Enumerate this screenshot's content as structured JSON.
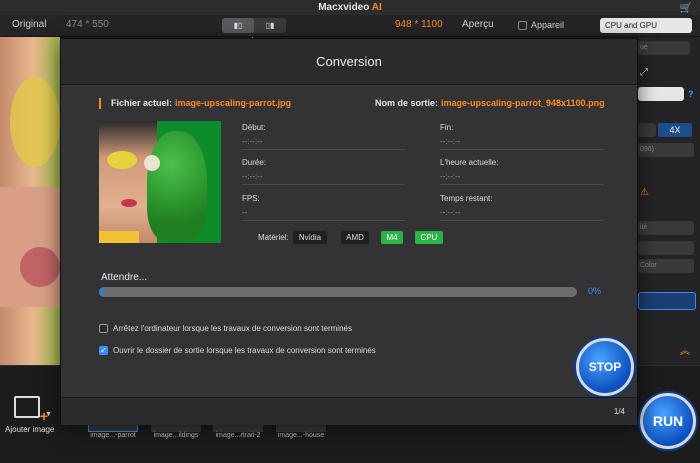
{
  "app": {
    "title": "Macxvideo",
    "title_accent": "AI"
  },
  "toolbar": {
    "original_label": "Original",
    "original_size": "474 * 550",
    "output_size": "948 * 1100",
    "apercu_label": "Aperçu",
    "appareil_label": "Appareil",
    "processor_select": "CPU and GPU"
  },
  "right_panel": {
    "scale_option": "4X",
    "help": "?",
    "dimension_partial": "096)",
    "item_partial_1": "ue",
    "item_partial_2": "ité",
    "item_partial_3": "Color"
  },
  "bottom": {
    "add_image_label": "Ajouter image",
    "thumbnails": [
      {
        "label": "image...-parrot"
      },
      {
        "label": "image...ildings"
      },
      {
        "label": "image...rtrait-2"
      },
      {
        "label": "image...-house"
      }
    ],
    "run_label": "RUN"
  },
  "dialog": {
    "title": "Conversion",
    "current_file_label": "Fichier actuel:",
    "current_file": "image-upscaling-parrot.jpg",
    "output_name_label": "Nom de sortie:",
    "output_name": "image-upscaling-parrot_948x1100.png",
    "fields": {
      "debut_label": "Début:",
      "debut_value": "--:--:--",
      "fin_label": "Fin:",
      "fin_value": "--:--:--",
      "duree_label": "Durée:",
      "duree_value": "--:--:--",
      "heure_label": "L'heure actuelle:",
      "heure_value": "--:--:--",
      "fps_label": "FPS:",
      "fps_value": "--",
      "restant_label": "Temps restant:",
      "restant_value": "--:--:--"
    },
    "materiel_label": "Matériel:",
    "hardware": [
      "Nvidia",
      "AMD",
      "M4",
      "CPU"
    ],
    "status_label": "Attendre...",
    "progress_percent": 0,
    "progress_text": "0%",
    "option_shutdown": {
      "label": "Arrêtez l'ordinateur lorsque les travaux de conversion sont terminés",
      "checked": false
    },
    "option_open_folder": {
      "label": "Ouvrir le dossier de sortie lorsque les travaux de conversion sont terminés",
      "checked": true
    },
    "stop_label": "STOP",
    "count": "1/4"
  },
  "colors": {
    "accent": "#ff8a1f",
    "blue": "#3d8cff",
    "green": "#2cb34a"
  }
}
